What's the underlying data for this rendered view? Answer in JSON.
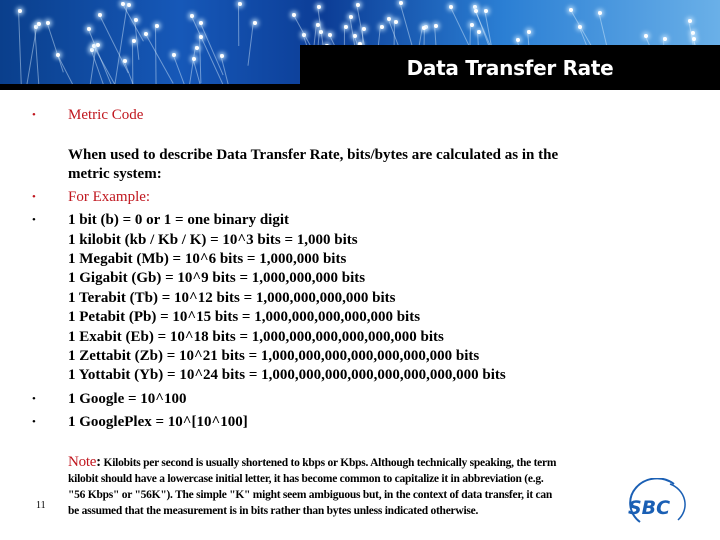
{
  "slide": {
    "title": "Data Transfer Rate",
    "page_number": "11",
    "accent_color": "#c0161e",
    "heading": "Metric Code",
    "intro_line1": "When used to describe Data Transfer Rate, bits/bytes are calculated as in the",
    "intro_line2": "metric system:",
    "example_label": "For Example:",
    "units": [
      "1 bit (b) = 0 or 1 = one binary digit",
      "1 kilobit (kb / Kb / K) = 10^3 bits = 1,000 bits",
      "1 Megabit (Mb) = 10^6 bits = 1,000,000 bits",
      "1 Gigabit (Gb) = 10^9 bits = 1,000,000,000 bits",
      "1 Terabit (Tb) = 10^12 bits = 1,000,000,000,000 bits",
      "1 Petabit (Pb) = 10^15 bits = 1,000,000,000,000,000 bits",
      "1 Exabit (Eb) = 10^18 bits = 1,000,000,000,000,000,000 bits",
      "1 Zettabit (Zb) = 10^21 bits = 1,000,000,000,000,000,000,000 bits",
      "1 Yottabit (Yb) = 10^24 bits = 1,000,000,000,000,000,000,000,000 bits"
    ],
    "google": "1 Google = 10^100",
    "googleplex": "1 GooglePlex = 10^[10^100]",
    "note_label": "Note",
    "note_colon": ":",
    "note_lines": [
      " Kilobits per second is usually shortened to kbps or Kbps. Although technically speaking, the term",
      "kilobit should have a lowercase initial letter, it has become common to capitalize it in abbreviation (e.g.",
      "\"56 Kbps\" or \"56K\"). The simple \"K\" might seem ambiguous but, in the context of data transfer, it can",
      "be assumed that the measurement is in bits rather than bytes unless indicated otherwise."
    ],
    "logo_text": "SBC"
  }
}
